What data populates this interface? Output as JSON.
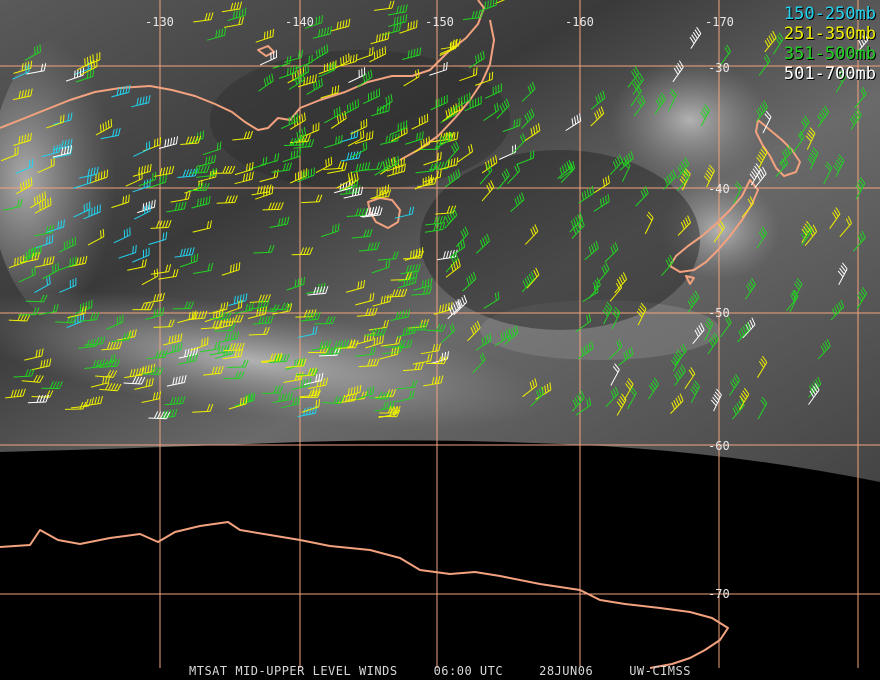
{
  "map": {
    "satellite_region": "Southern Ocean south of Australia / New Zealand",
    "background": "water vapor imagery",
    "longitude_labels": [
      "-130",
      "-140",
      "-150",
      "-160",
      "-170"
    ],
    "latitude_labels": [
      "-30",
      "-40",
      "-50",
      "-60",
      "-70"
    ],
    "coastline_color": "#f2a27e",
    "grid_color": "#f2a27e"
  },
  "legend": [
    {
      "label": "150-250mb",
      "color": "#22d4f0"
    },
    {
      "label": "251-350mb",
      "color": "#f0f000"
    },
    {
      "label": "351-500mb",
      "color": "#22d422"
    },
    {
      "label": "501-700mb",
      "color": "#ffffff"
    }
  ],
  "footer": {
    "product": "MTSAT MID-UPPER LEVEL WINDS",
    "time": "06:00 UTC",
    "date": "28JUN06",
    "source": "UW-CIMSS"
  }
}
